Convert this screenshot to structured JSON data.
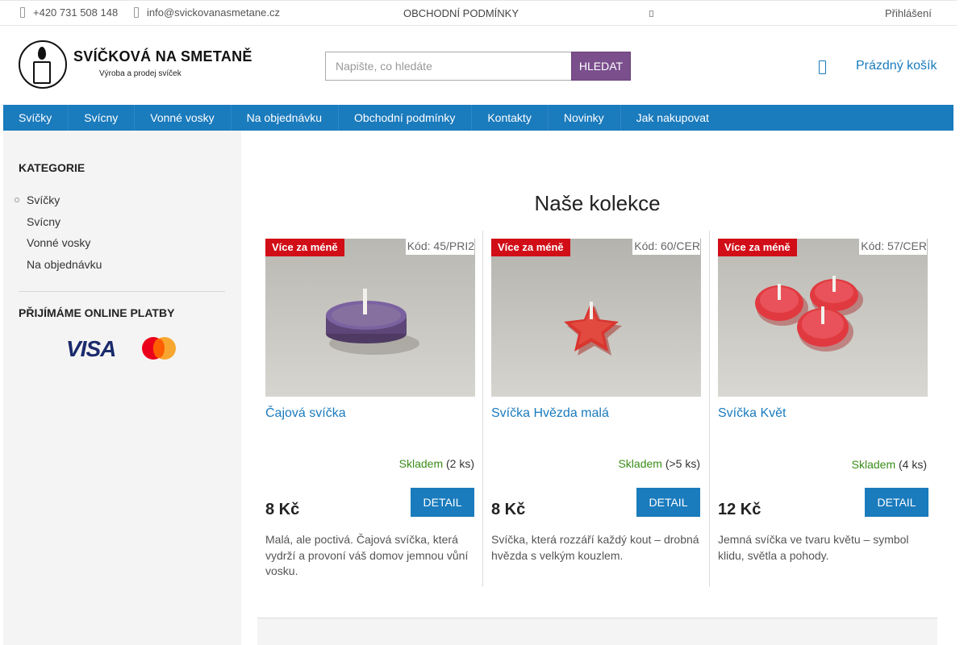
{
  "topbar": {
    "phone": "+420 731 508 148",
    "email": "info@svickovanasmetane.cz",
    "terms_link": "OBCHODNÍ PODMÍNKY",
    "login": "Přihlášení"
  },
  "logo": {
    "title": "SVÍČKOVÁ NA SMETANĚ",
    "subtitle": "Výroba a prodej svíček"
  },
  "search": {
    "placeholder": "Napište, co hledáte",
    "button": "HLEDAT"
  },
  "cart": {
    "label": "Prázdný košík"
  },
  "nav": {
    "items": [
      "Svíčky",
      "Svícny",
      "Vonné vosky",
      "Na objednávku",
      "Obchodní podmínky",
      "Kontakty",
      "Novinky",
      "Jak nakupovat"
    ]
  },
  "sidebar": {
    "categories_heading": "KATEGORIE",
    "categories": [
      "Svíčky",
      "Svícny",
      "Vonné vosky",
      "Na objednávku"
    ],
    "payments_heading": "PŘIJÍMÁME ONLINE PLATBY",
    "payment_logos": [
      "VISA",
      "mastercard"
    ]
  },
  "main": {
    "title": "Naše kolekce",
    "products": [
      {
        "badge": "Více za méně",
        "code": "Kód: 45/PRI2",
        "name": "Čajová svíčka",
        "stock_label": "Skladem",
        "stock_count": "(2 ks)",
        "price": "8 Kč",
        "detail": "DETAIL",
        "description": "Malá, ale poctivá. Čajová svíčka, která vydrží a provoní váš domov jemnou vůní vosku.",
        "color": "#6a4f86"
      },
      {
        "badge": "Více za méně",
        "code": "Kód: 60/CER",
        "name": "Svíčka Hvězda malá",
        "stock_label": "Skladem",
        "stock_count": "(>5 ks)",
        "price": "8 Kč",
        "detail": "DETAIL",
        "description": "Svíčka, která rozzáří každý kout – drobná hvězda s velkým kouzlem.",
        "color": "#d8362f"
      },
      {
        "badge": "Více za méně",
        "code": "Kód: 57/CER",
        "name": "Svíčka Květ",
        "stock_label": "Skladem",
        "stock_count": "(4 ks)",
        "price": "12 Kč",
        "detail": "DETAIL",
        "description": "Jemná svíčka ve tvaru květu – symbol klidu, světla a pohody.",
        "color": "#e03a40"
      }
    ]
  },
  "colors": {
    "nav_blue": "#1a7bbd",
    "search_button": "#7a4f8c",
    "badge_red": "#d10d17",
    "stock_green": "#3a8d18"
  }
}
